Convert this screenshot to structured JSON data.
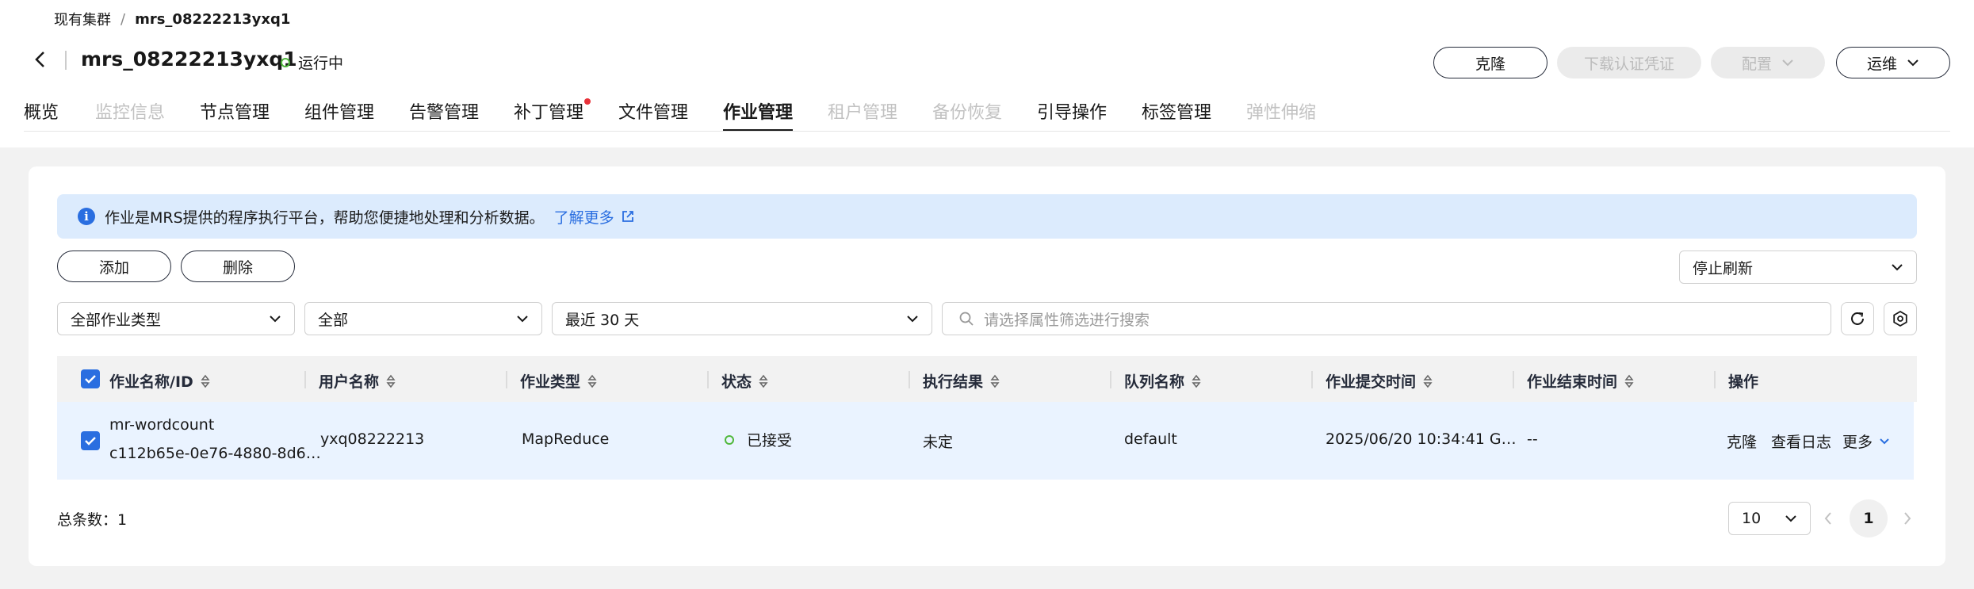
{
  "breadcrumb": {
    "parent": "现有集群",
    "separator": "/",
    "current": "mrs_08222213yxq1"
  },
  "header": {
    "title": "mrs_08222213yxq1",
    "status": "运行中",
    "buttons": {
      "clone": "克隆",
      "download": "下载认证凭证",
      "config": "配置",
      "ops": "运维"
    }
  },
  "tabs": [
    {
      "label": "概览"
    },
    {
      "label": "监控信息"
    },
    {
      "label": "节点管理"
    },
    {
      "label": "组件管理"
    },
    {
      "label": "告警管理"
    },
    {
      "label": "补丁管理"
    },
    {
      "label": "文件管理"
    },
    {
      "label": "作业管理"
    },
    {
      "label": "租户管理"
    },
    {
      "label": "备份恢复"
    },
    {
      "label": "引导操作"
    },
    {
      "label": "标签管理"
    },
    {
      "label": "弹性伸缩"
    }
  ],
  "info": {
    "text": "作业是MRS提供的程序执行平台，帮助您便捷地处理和分析数据。",
    "link": "了解更多"
  },
  "toolbar": {
    "add": "添加",
    "delete": "删除",
    "refresh": "停止刷新"
  },
  "filters": {
    "job_type": "全部作业类型",
    "status": "全部",
    "time_range": "最近 30 天",
    "search_placeholder": "请选择属性筛选进行搜索"
  },
  "table": {
    "columns": [
      "作业名称/ID",
      "用户名称",
      "作业类型",
      "状态",
      "执行结果",
      "队列名称",
      "作业提交时间",
      "作业结束时间",
      "操作"
    ],
    "rows": [
      {
        "name": "mr-wordcount",
        "id": "c112b65e-0e76-4880-8d6…",
        "user": "yxq08222213",
        "type": "MapReduce",
        "status": "已接受",
        "result": "未定",
        "queue": "default",
        "submit_time": "2025/06/20 10:34:41 G…",
        "end_time": "--",
        "actions": {
          "clone": "克隆",
          "logs": "查看日志",
          "more": "更多"
        }
      }
    ]
  },
  "footer": {
    "total_label": "总条数：1",
    "page_size": "10",
    "page": "1"
  },
  "colors": {
    "accent": "#2a6ee0",
    "running": "#50b83c",
    "badge": "#e8323a",
    "info_bg": "#dcebfd"
  }
}
